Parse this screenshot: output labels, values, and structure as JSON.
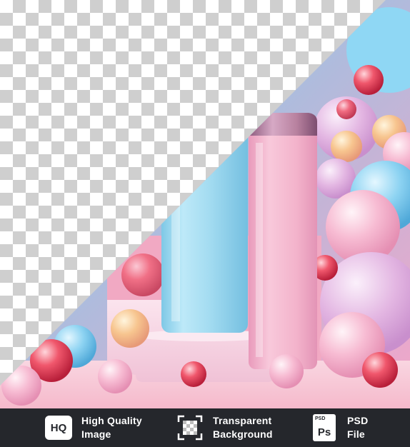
{
  "badges": [
    {
      "icon": "hq-icon",
      "line1": "High Quality",
      "line2": "Image",
      "icon_text": "HQ"
    },
    {
      "icon": "transparent-grid-icon",
      "line1": "Transparent",
      "line2": "Background"
    },
    {
      "icon": "psd-file-icon",
      "line1": "PSD",
      "line2": "File",
      "icon_tag": "PSD",
      "icon_text": "Ps"
    }
  ],
  "colors": {
    "bar_background": "#25272c",
    "can_blue": "#9fd8ef",
    "can_pink": "#f2b6cc",
    "lid": "#b07a9f",
    "backdrop_blue": "#7cc9ec",
    "floor_pink": "#f6c9d6"
  }
}
